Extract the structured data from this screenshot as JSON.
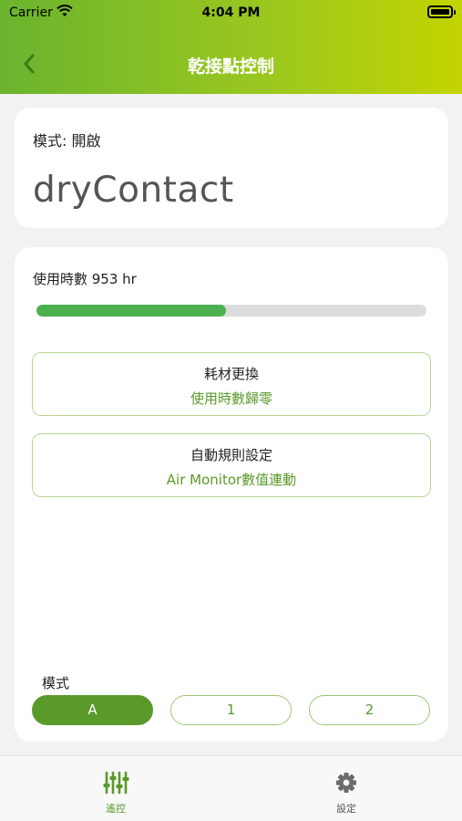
{
  "status_bar": {
    "carrier": "Carrier",
    "time": "4:04 PM"
  },
  "header": {
    "title": "乾接點控制"
  },
  "info_card": {
    "mode_status": "模式: 開啟",
    "device_name": "dryContact"
  },
  "usage": {
    "label": "使用時數 953 hr",
    "progress_fraction": 0.485
  },
  "actions": {
    "reset": {
      "title": "耗材更換",
      "subtitle": "使用時數歸零"
    },
    "rule": {
      "title": "自動規則設定",
      "subtitle": "Air Monitor數值連動"
    }
  },
  "mode": {
    "label": "模式",
    "options": [
      "A",
      "1",
      "2"
    ],
    "selected": "A"
  },
  "tabbar": {
    "items": [
      {
        "label": "遙控",
        "icon": "sliders-icon"
      },
      {
        "label": "設定",
        "icon": "gear-icon"
      }
    ]
  },
  "colors": {
    "accent": "#5a9a2a",
    "progress": "#4caf50",
    "header_start": "#6ab42e",
    "header_end": "#c3d400"
  }
}
